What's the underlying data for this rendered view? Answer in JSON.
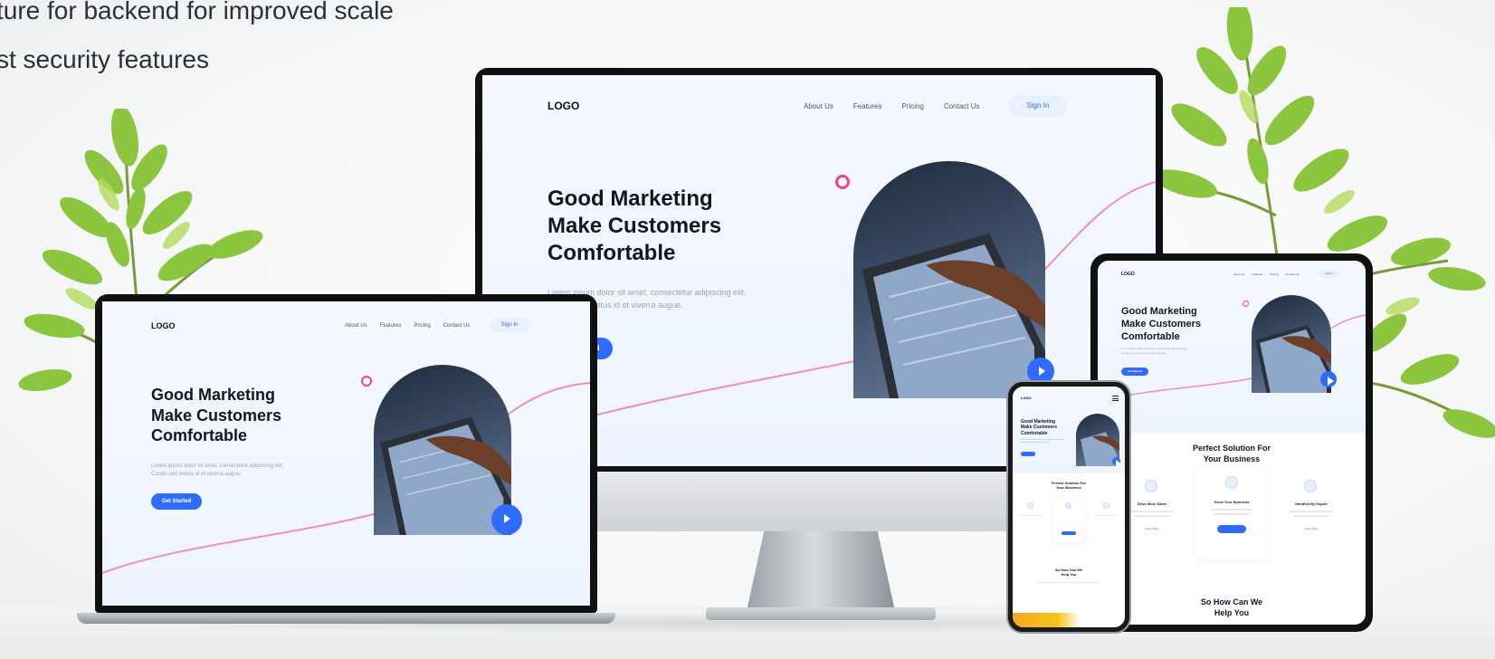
{
  "captions": [
    "ture for backend for improved scale",
    "st security features"
  ],
  "mockup": {
    "logo": "LOGO",
    "nav": [
      "About Us",
      "Features",
      "Pricing",
      "Contact Us"
    ],
    "signin": "Sign In",
    "headline": [
      "Good Marketing",
      "Make Customers",
      "Comfortable"
    ],
    "description": [
      "Lorem ipsum dolor sit amet, consectetur adipiscing elit.",
      "Curabi sed metus id et viverra augue."
    ],
    "cta": "Get Started",
    "section_title": [
      "Perfect Solution For",
      "Your Business"
    ],
    "cards": [
      {
        "title": "Drive More Sales",
        "link": "Learn More"
      },
      {
        "title": "Grow Your Business",
        "link": "Learn More"
      },
      {
        "title": "Handled By Expert",
        "link": "Learn More"
      }
    ],
    "help_title": [
      "So How Can We",
      "Help You"
    ]
  },
  "colors": {
    "accent": "#2f6bff",
    "pink": "#f0438a",
    "text_dark": "#101828",
    "leaf": "#8cc63f"
  },
  "icons": [
    "play-icon",
    "menu-icon",
    "plant-decoration"
  ]
}
